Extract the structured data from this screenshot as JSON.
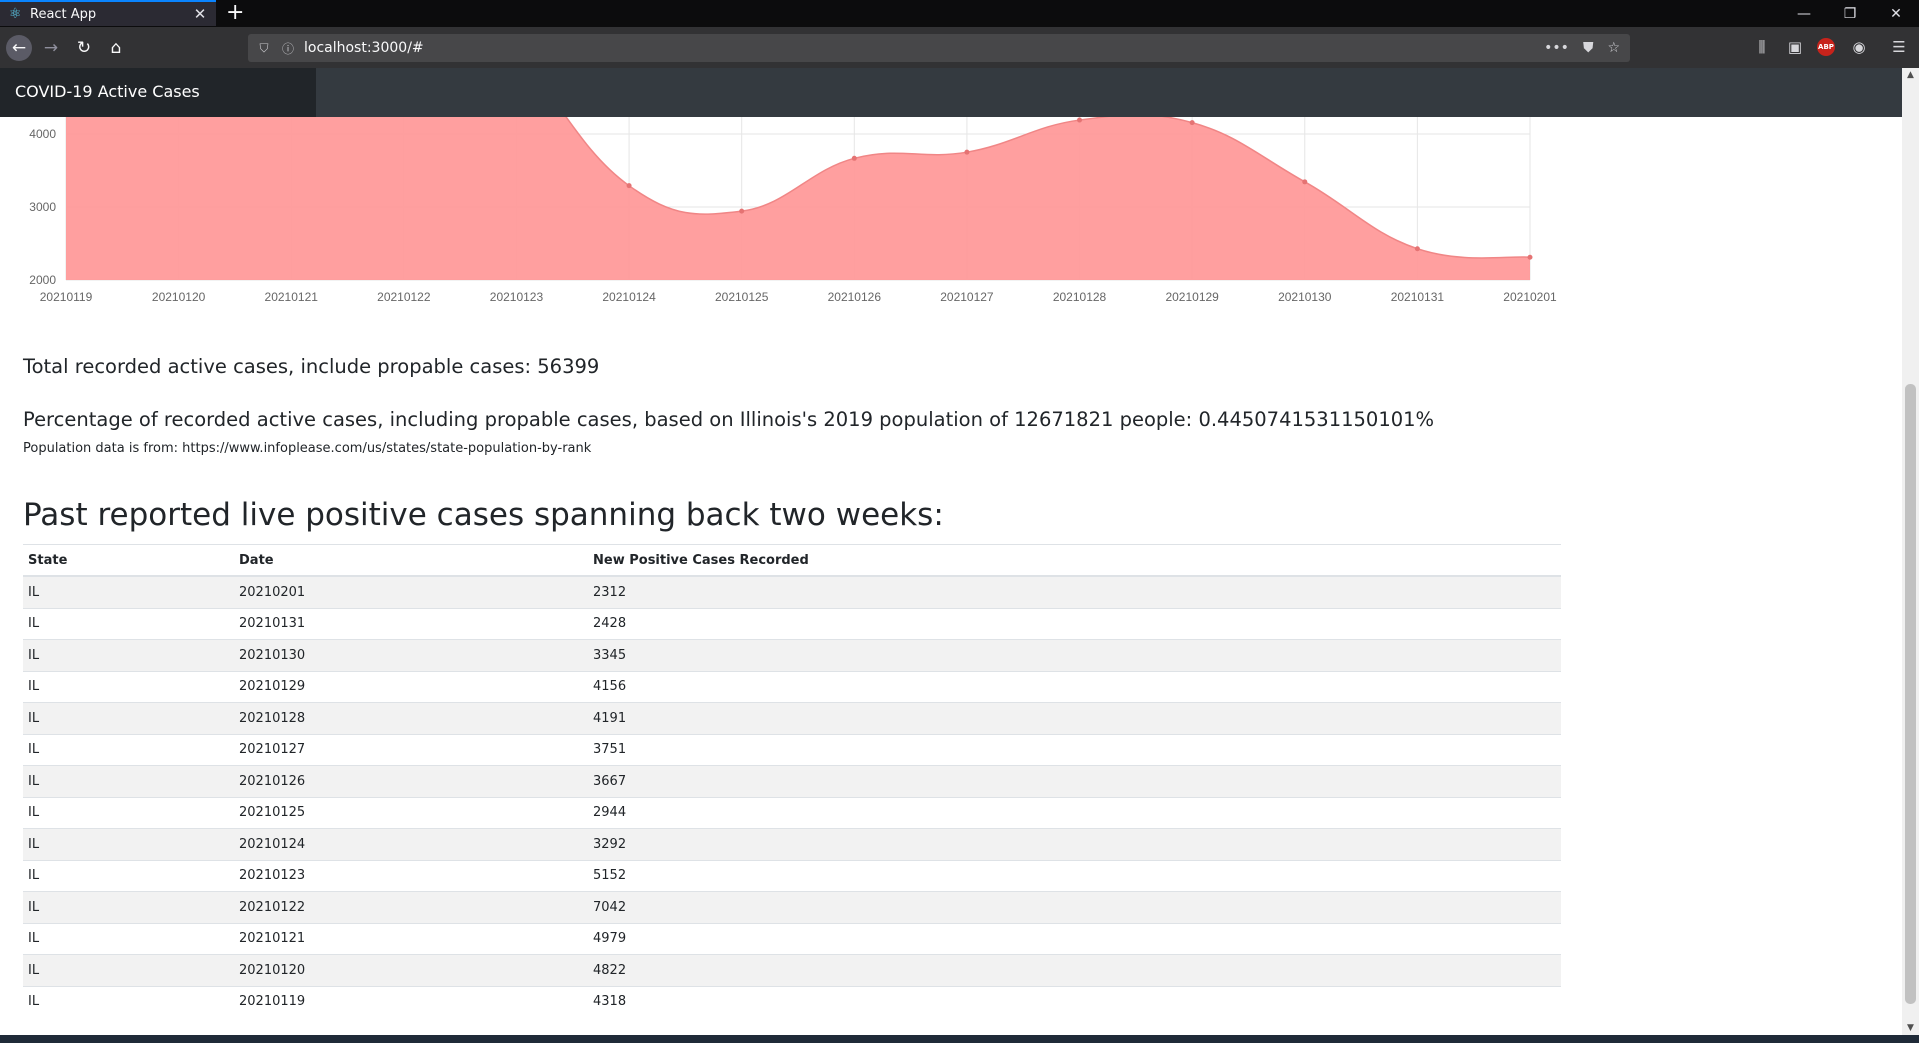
{
  "browser": {
    "tab_title": "React App",
    "url": "localhost:3000/#",
    "abp_label": "ABP"
  },
  "app": {
    "brand": "COVID-19 Active Cases"
  },
  "chart_data": {
    "type": "area",
    "x": [
      "20210119",
      "20210120",
      "20210121",
      "20210122",
      "20210123",
      "20210124",
      "20210125",
      "20210126",
      "20210127",
      "20210128",
      "20210129",
      "20210130",
      "20210131",
      "20210201"
    ],
    "series": [
      {
        "values": [
          4318,
          4822,
          4979,
          7042,
          5152,
          3292,
          2944,
          3667,
          3751,
          4191,
          4156,
          3345,
          2428,
          2312
        ]
      }
    ],
    "y_ticks_visible": [
      2000,
      3000,
      4000
    ],
    "ylim": [
      2000,
      8000
    ],
    "grid": true,
    "fill_color": "#ff9a9a",
    "line_color": "#f08686"
  },
  "stats": {
    "total_text": "Total recorded active cases, include propable cases: 56399",
    "percent_text": "Percentage of recorded active cases, including propable cases, based on Illinois's 2019 population of 12671821 people: 0.4450741531150101%",
    "source_note": "Population data is from: https://www.infoplease.com/us/states/state-population-by-rank"
  },
  "table": {
    "heading": "Past reported live positive cases spanning back two weeks:",
    "columns": [
      "State",
      "Date",
      "New Positive Cases Recorded"
    ],
    "rows": [
      [
        "IL",
        "20210201",
        "2312"
      ],
      [
        "IL",
        "20210131",
        "2428"
      ],
      [
        "IL",
        "20210130",
        "3345"
      ],
      [
        "IL",
        "20210129",
        "4156"
      ],
      [
        "IL",
        "20210128",
        "4191"
      ],
      [
        "IL",
        "20210127",
        "3751"
      ],
      [
        "IL",
        "20210126",
        "3667"
      ],
      [
        "IL",
        "20210125",
        "2944"
      ],
      [
        "IL",
        "20210124",
        "3292"
      ],
      [
        "IL",
        "20210123",
        "5152"
      ],
      [
        "IL",
        "20210122",
        "7042"
      ],
      [
        "IL",
        "20210121",
        "4979"
      ],
      [
        "IL",
        "20210120",
        "4822"
      ],
      [
        "IL",
        "20210119",
        "4318"
      ]
    ]
  }
}
